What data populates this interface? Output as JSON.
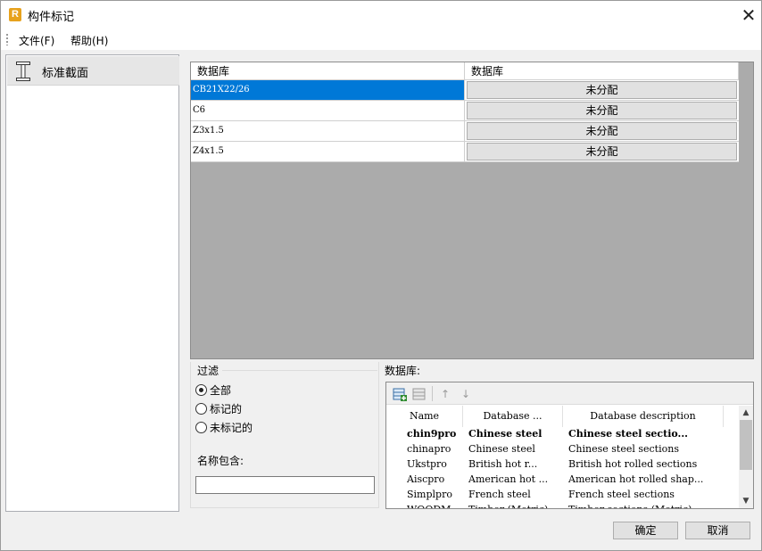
{
  "window": {
    "title": "构件标记",
    "app_icon_letter": "R"
  },
  "menu": {
    "file": "文件(F)",
    "help": "帮助(H)"
  },
  "tree": {
    "items": [
      {
        "label": "标准截面",
        "icon": "i-beam-icon"
      }
    ]
  },
  "grid": {
    "headers": [
      "数据库",
      "数据库"
    ],
    "rows": [
      {
        "name": "CB21X22/26",
        "value": "未分配",
        "selected": true
      },
      {
        "name": "C6",
        "value": "未分配",
        "selected": false
      },
      {
        "name": "Z3x1.5",
        "value": "未分配",
        "selected": false
      },
      {
        "name": "Z4x1.5",
        "value": "未分配",
        "selected": false
      }
    ]
  },
  "filter": {
    "title": "过滤",
    "options": [
      {
        "label": "全部",
        "checked": true
      },
      {
        "label": "标记的",
        "checked": false
      },
      {
        "label": "未标记的",
        "checked": false
      }
    ],
    "name_contains_label": "名称包含:",
    "name_contains_value": ""
  },
  "database": {
    "label": "数据库:",
    "toolbar": [
      "add-database-icon",
      "remove-database-icon",
      "move-up-icon",
      "move-down-icon"
    ],
    "columns": [
      "Name",
      "Database ...",
      "Database description"
    ],
    "rows": [
      {
        "name": "chin9pro",
        "db": "Chinese steel",
        "desc": "Chinese steel sectio...",
        "bold": true
      },
      {
        "name": "chinapro",
        "db": "Chinese steel",
        "desc": "Chinese steel sections",
        "bold": false
      },
      {
        "name": "Ukstpro",
        "db": "British hot r...",
        "desc": "British hot rolled sections",
        "bold": false
      },
      {
        "name": "Aiscpro",
        "db": "American hot ...",
        "desc": "American hot rolled shap...",
        "bold": false
      },
      {
        "name": "Simplpro",
        "db": "French steel",
        "desc": "French steel sections",
        "bold": false
      },
      {
        "name": "WOODM",
        "db": "Timber (Metric)",
        "desc": "Timber sections (Metric)",
        "bold": false
      }
    ]
  },
  "buttons": {
    "ok": "确定",
    "cancel": "取消"
  }
}
